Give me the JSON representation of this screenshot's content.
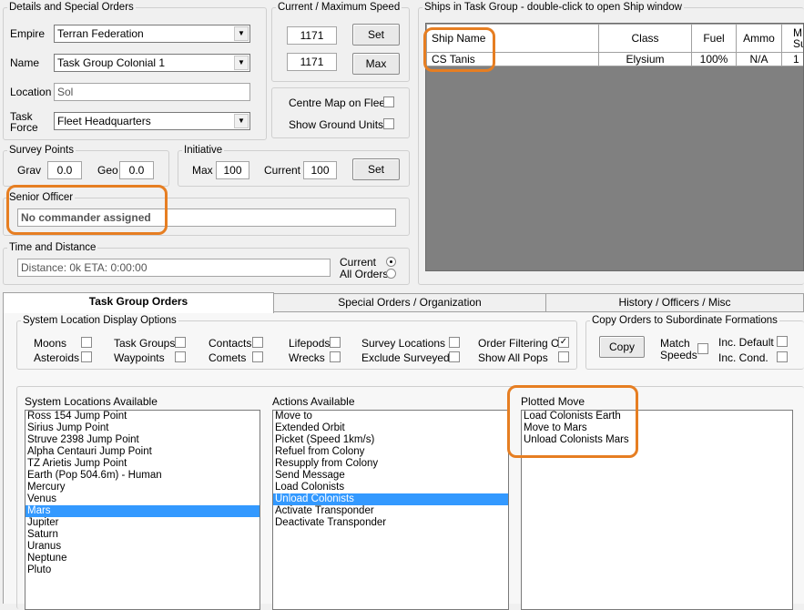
{
  "details": {
    "legend": "Details and Special Orders",
    "empire_label": "Empire",
    "empire_value": "Terran Federation",
    "name_label": "Name",
    "name_value": "Task Group Colonial 1",
    "location_label": "Location",
    "location_value": "Sol",
    "taskforce_label_1": "Task",
    "taskforce_label_2": "Force",
    "taskforce_value": "Fleet Headquarters"
  },
  "speed": {
    "legend": "Current / Maximum Speed",
    "current_value": "1171",
    "max_value": "1171",
    "set_label": "Set",
    "max_label": "Max"
  },
  "map_options": {
    "centre_label": "Centre Map on Fleet",
    "ground_label": "Show Ground Units"
  },
  "survey": {
    "legend": "Survey Points",
    "grav_label": "Grav",
    "grav_value": "0.0",
    "geo_label": "Geo",
    "geo_value": "0.0"
  },
  "initiative": {
    "legend": "Initiative",
    "max_label": "Max",
    "max_value": "100",
    "current_label": "Current",
    "current_value": "100",
    "set_label": "Set"
  },
  "officer": {
    "legend": "Senior Officer",
    "value": "No commander assigned"
  },
  "time_distance": {
    "legend": "Time and Distance",
    "value": "Distance: 0k  ETA: 0:00:00",
    "current_label": "Current",
    "all_orders_label": "All Orders"
  },
  "ships": {
    "legend": "Ships in Task Group - double-click to open Ship window",
    "columns": [
      "Ship Name",
      "Class",
      "Fuel",
      "Ammo",
      "M Sup"
    ],
    "column_last_line1": "M",
    "column_last_line2": "Sup",
    "rows": [
      {
        "name": "CS Tanis",
        "class": "Elysium",
        "fuel": "100%",
        "ammo": "N/A",
        "sup": "1"
      }
    ]
  },
  "tabs": [
    {
      "label": "Task Group Orders"
    },
    {
      "label": "Special Orders / Organization"
    },
    {
      "label": "History / Officers / Misc"
    }
  ],
  "display_options": {
    "legend": "System Location Display Options",
    "moons": "Moons",
    "asteroids": "Asteroids",
    "task_groups": "Task Groups",
    "waypoints": "Waypoints",
    "contacts": "Contacts",
    "comets": "Comets",
    "lifepods": "Lifepods",
    "wrecks": "Wrecks",
    "survey_locations": "Survey Locations",
    "exclude_surveyed": "Exclude Surveyed",
    "order_filtering": "Order Filtering On",
    "show_all_pops": "Show All Pops"
  },
  "copy_orders": {
    "legend": "Copy Orders to Subordinate Formations",
    "copy_label": "Copy",
    "match_label_1": "Match",
    "match_label_2": "Speeds",
    "inc_default": "Inc. Default",
    "inc_cond": "Inc. Cond."
  },
  "system_locations": {
    "title": "System Locations Available",
    "items": [
      "Ross 154 Jump Point",
      "Sirius Jump Point",
      "Struve 2398 Jump Point",
      "Alpha Centauri Jump Point",
      "TZ Arietis Jump Point",
      "Earth  (Pop 504.6m) - Human",
      "Mercury",
      "Venus",
      "Mars",
      "Jupiter",
      "Saturn",
      "Uranus",
      "Neptune",
      "Pluto"
    ]
  },
  "actions": {
    "title": "Actions Available",
    "items": [
      "Move to",
      "Extended Orbit",
      "Picket (Speed 1km/s)",
      "Refuel from Colony",
      "Resupply from Colony",
      "Send Message",
      "Load Colonists",
      "Unload Colonists",
      "Activate Transponder",
      "Deactivate Transponder"
    ]
  },
  "plotted_move": {
    "title": "Plotted Move",
    "items": [
      "Load Colonists Earth",
      "Move to Mars",
      "Unload Colonists Mars"
    ]
  },
  "colors": {
    "highlight": "#e67e22",
    "selection": "#3399ff",
    "grid_background": "#808080"
  }
}
